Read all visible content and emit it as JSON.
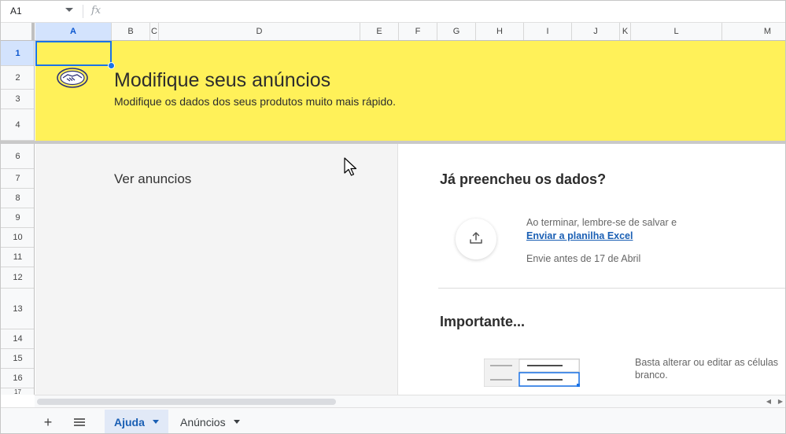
{
  "formula_bar": {
    "cell_ref": "A1",
    "fx_symbol": "fx"
  },
  "columns": [
    "A",
    "B",
    "C",
    "D",
    "E",
    "F",
    "G",
    "H",
    "I",
    "J",
    "K",
    "L",
    "M"
  ],
  "rows": [
    "1",
    "2",
    "3",
    "4",
    "6",
    "7",
    "8",
    "9",
    "10",
    "11",
    "12",
    "13",
    "14",
    "15",
    "16",
    "17"
  ],
  "banner": {
    "title": "Modifique seus anúncios",
    "subtitle": "Modifique os dados dos seus produtos muito mais rápido.",
    "background": "#fff159"
  },
  "left_panel": {
    "heading": "Ver anuncios"
  },
  "right_panel": {
    "title": "Já preencheu os dados?",
    "reminder": "Ao terminar, lembre-se de salvar e",
    "link": "Enviar a planilha Excel",
    "deadline": "Envie antes de 17 de Abril",
    "important_title": "Importante...",
    "important_text_line1": "Basta alterar ou editar as células",
    "important_text_line2": "branco."
  },
  "tabs": [
    {
      "label": "Ajuda",
      "active": true
    },
    {
      "label": "Anúncios",
      "active": false
    }
  ],
  "icons": {
    "add": "plus-icon",
    "all_sheets": "hamburger-icon",
    "upload": "upload-icon",
    "logo": "handshake-icon"
  },
  "colors": {
    "accent": "#1a73e8",
    "link": "#1a5fb4",
    "selection": "#d3e3fd"
  }
}
